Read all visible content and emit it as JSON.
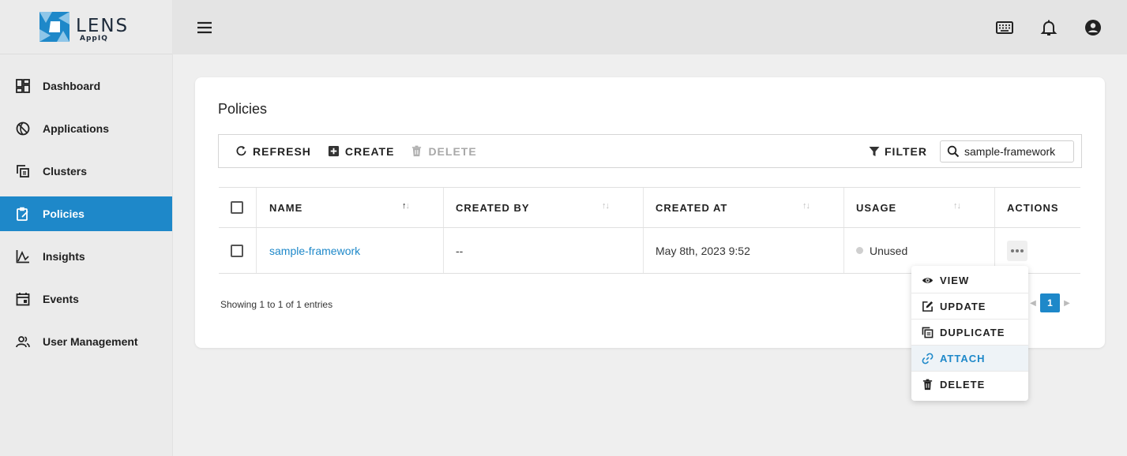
{
  "brand": {
    "name": "LENS",
    "sub": "AppIQ"
  },
  "sidebar": {
    "items": [
      {
        "label": "Dashboard",
        "icon": "dashboard-icon"
      },
      {
        "label": "Applications",
        "icon": "applications-icon"
      },
      {
        "label": "Clusters",
        "icon": "clusters-icon"
      },
      {
        "label": "Policies",
        "icon": "policies-icon",
        "active": true
      },
      {
        "label": "Insights",
        "icon": "insights-icon"
      },
      {
        "label": "Events",
        "icon": "events-icon"
      },
      {
        "label": "User Management",
        "icon": "users-icon"
      }
    ]
  },
  "topbar": {
    "icons": [
      "menu-icon",
      "keyboard-icon",
      "bell-icon",
      "account-icon"
    ]
  },
  "page": {
    "title": "Policies"
  },
  "toolbar": {
    "refresh": "REFRESH",
    "create": "CREATE",
    "delete": "DELETE",
    "filter": "FILTER",
    "search_value": "sample-framework"
  },
  "table": {
    "columns": [
      "NAME",
      "CREATED BY",
      "CREATED AT",
      "USAGE",
      "ACTIONS"
    ],
    "rows": [
      {
        "name": "sample-framework",
        "created_by": "--",
        "created_at": "May 8th, 2023 9:52",
        "usage": "Unused"
      }
    ],
    "info": "Showing 1 to 1 of 1 entries",
    "page": "1"
  },
  "menu": {
    "items": [
      {
        "label": "VIEW",
        "icon": "eye-icon"
      },
      {
        "label": "UPDATE",
        "icon": "edit-icon"
      },
      {
        "label": "DUPLICATE",
        "icon": "copy-icon"
      },
      {
        "label": "ATTACH",
        "icon": "link-icon",
        "highlighted": true
      },
      {
        "label": "DELETE",
        "icon": "trash-icon"
      }
    ]
  },
  "colors": {
    "accent": "#1e88c9",
    "sidebar": "#ebebeb",
    "topbar": "#e4e4e4"
  }
}
